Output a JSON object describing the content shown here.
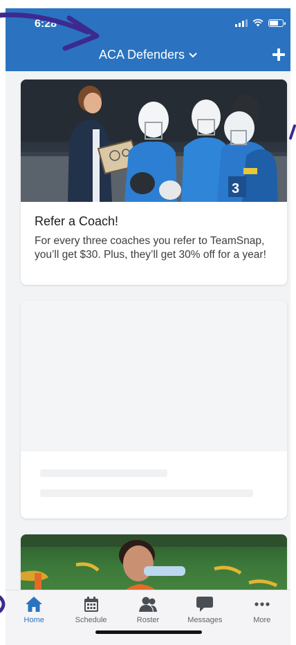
{
  "status_bar": {
    "time": "6:28"
  },
  "header": {
    "team_name": "ACA Defenders",
    "background": "#2b73c0"
  },
  "cards": [
    {
      "title": "Refer a Coach!",
      "text": "For every three coaches you refer to TeamSnap, you’ll get $30. Plus, they’ll get 30% off for a year!"
    }
  ],
  "tabs": [
    {
      "label": "Home",
      "icon": "home-icon",
      "active": true
    },
    {
      "label": "Schedule",
      "icon": "calendar-icon",
      "active": false
    },
    {
      "label": "Roster",
      "icon": "people-icon",
      "active": false
    },
    {
      "label": "Messages",
      "icon": "chat-bubble-icon",
      "active": false
    },
    {
      "label": "More",
      "icon": "ellipsis-icon",
      "active": false
    }
  ],
  "colors": {
    "accent": "#2b73c0",
    "annotation": "#3d2a8f",
    "tab_inactive": "#5f6368"
  }
}
